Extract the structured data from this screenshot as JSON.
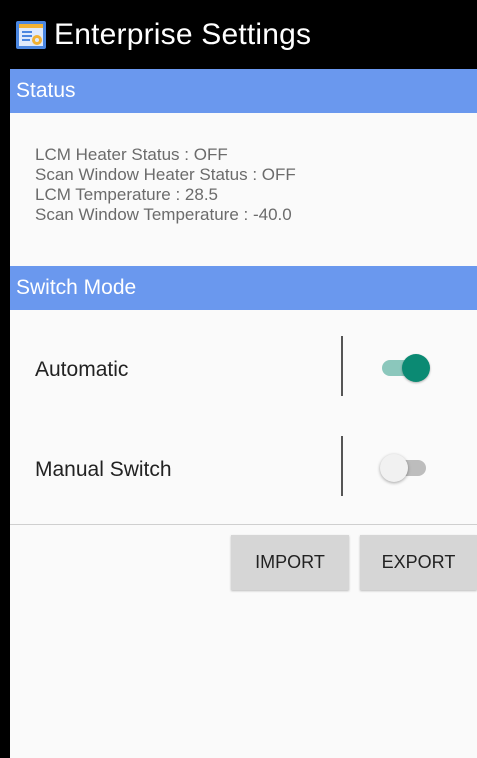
{
  "app": {
    "title": "Enterprise Settings",
    "icon": "settings-document-icon"
  },
  "status": {
    "header": "Status",
    "lines": [
      "LCM Heater Status : OFF",
      "Scan Window Heater Status : OFF",
      "LCM Temperature : 28.5",
      "Scan Window Temperature : -40.0"
    ]
  },
  "switch_mode": {
    "header": "Switch Mode",
    "options": [
      {
        "label": "Automatic",
        "enabled": true
      },
      {
        "label": "Manual Switch",
        "enabled": false
      }
    ]
  },
  "actions": {
    "import_label": "IMPORT",
    "export_label": "EXPORT"
  },
  "colors": {
    "section_header": "#6a98ee",
    "toggle_on": "#0b8a73",
    "toggle_on_track": "#8bc7bc"
  }
}
